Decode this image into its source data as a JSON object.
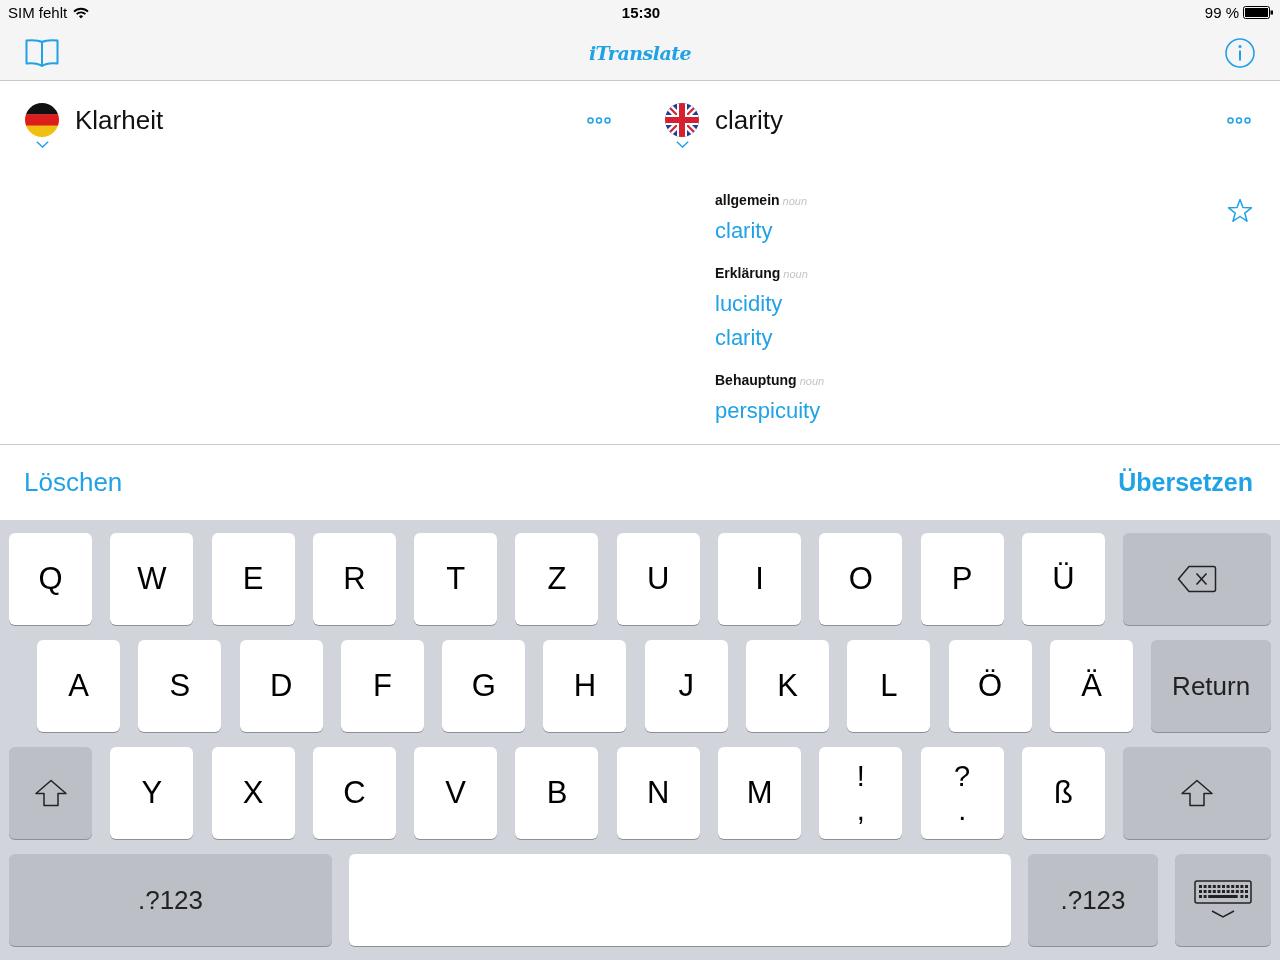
{
  "status_bar": {
    "carrier": "SIM fehlt",
    "time": "15:30",
    "battery": "99 %"
  },
  "nav_bar": {
    "title": "iTranslate"
  },
  "source": {
    "text": "Klarheit"
  },
  "target": {
    "text": "clarity",
    "groups": [
      {
        "category": "allgemein",
        "part_of_speech": "noun",
        "translations": [
          "clarity"
        ]
      },
      {
        "category": "Erklärung",
        "part_of_speech": "noun",
        "translations": [
          "lucidity",
          "clarity"
        ]
      },
      {
        "category": "Behauptung",
        "part_of_speech": "noun",
        "translations": [
          "perspicuity"
        ]
      }
    ]
  },
  "actions": {
    "clear": "Löschen",
    "translate": "Übersetzen"
  },
  "keyboard": {
    "rows": [
      {
        "keys": [
          {
            "kind": "char",
            "label": "Q"
          },
          {
            "kind": "char",
            "label": "W"
          },
          {
            "kind": "char",
            "label": "E"
          },
          {
            "kind": "char",
            "label": "R"
          },
          {
            "kind": "char",
            "label": "T"
          },
          {
            "kind": "char",
            "label": "Z"
          },
          {
            "kind": "char",
            "label": "U"
          },
          {
            "kind": "char",
            "label": "I"
          },
          {
            "kind": "char",
            "label": "O"
          },
          {
            "kind": "char",
            "label": "P"
          },
          {
            "kind": "char",
            "label": "Ü"
          },
          {
            "kind": "backspace"
          }
        ]
      },
      {
        "keys": [
          {
            "kind": "char",
            "label": "A"
          },
          {
            "kind": "char",
            "label": "S"
          },
          {
            "kind": "char",
            "label": "D"
          },
          {
            "kind": "char",
            "label": "F"
          },
          {
            "kind": "char",
            "label": "G"
          },
          {
            "kind": "char",
            "label": "H"
          },
          {
            "kind": "char",
            "label": "J"
          },
          {
            "kind": "char",
            "label": "K"
          },
          {
            "kind": "char",
            "label": "L"
          },
          {
            "kind": "char",
            "label": "Ö"
          },
          {
            "kind": "char",
            "label": "Ä"
          },
          {
            "kind": "return",
            "label": "Return"
          }
        ]
      },
      {
        "keys": [
          {
            "kind": "shift"
          },
          {
            "kind": "char",
            "label": "Y"
          },
          {
            "kind": "char",
            "label": "X"
          },
          {
            "kind": "char",
            "label": "C"
          },
          {
            "kind": "char",
            "label": "V"
          },
          {
            "kind": "char",
            "label": "B"
          },
          {
            "kind": "char",
            "label": "N"
          },
          {
            "kind": "char",
            "label": "M"
          },
          {
            "kind": "dual",
            "top": "!",
            "bottom": ","
          },
          {
            "kind": "dual",
            "top": "?",
            "bottom": "."
          },
          {
            "kind": "char",
            "label": "ß"
          },
          {
            "kind": "shift"
          }
        ]
      },
      {
        "keys": [
          {
            "kind": "mode",
            "label": ".?123"
          },
          {
            "kind": "space"
          },
          {
            "kind": "mode",
            "label": ".?123"
          },
          {
            "kind": "dismiss"
          }
        ]
      }
    ]
  }
}
